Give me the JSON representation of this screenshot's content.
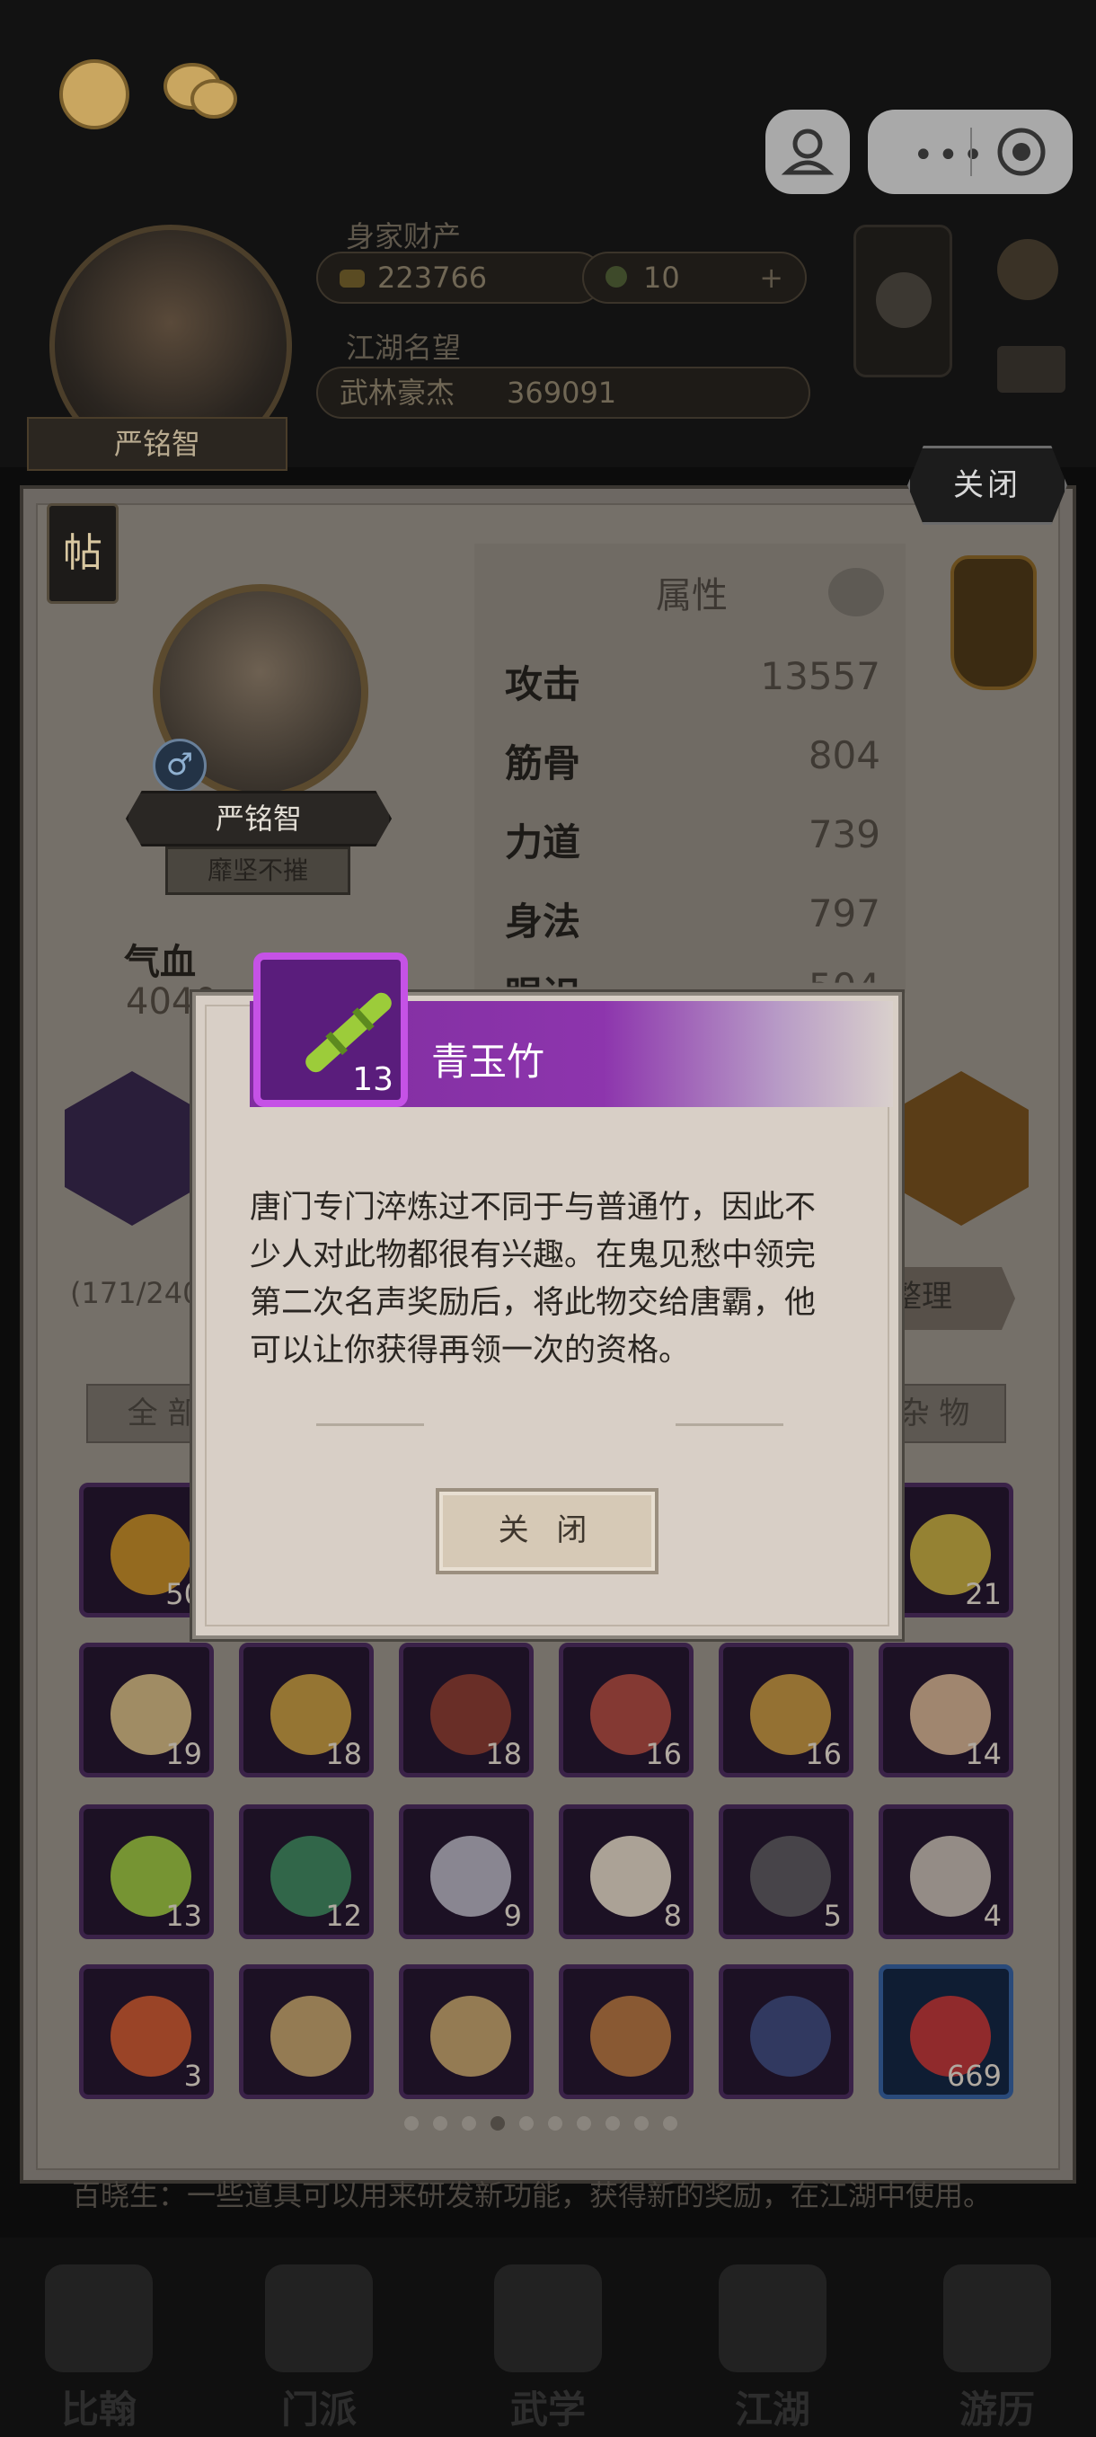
{
  "top": {
    "resources_label": "身家财产",
    "gold": "223766",
    "jade": "10",
    "plus": "+",
    "fame_label": "江湖名望",
    "fame_title": "武林豪杰",
    "fame_value": "369091",
    "player_name": "严铭智"
  },
  "panel": {
    "close_label": "关闭",
    "tie_label": "帖",
    "character_name": "严铭智",
    "character_title": "靡坚不摧",
    "gender_symbol": "♂",
    "hp_label": "气血",
    "hp_value": "4040",
    "attr_title": "属性",
    "attributes": [
      {
        "name": "攻击",
        "value": "13557"
      },
      {
        "name": "筋骨",
        "value": "804"
      },
      {
        "name": "力道",
        "value": "739"
      },
      {
        "name": "身法",
        "value": "797"
      },
      {
        "name": "眼识",
        "value": "504"
      }
    ],
    "capacity": "(171/240)",
    "arrange_label": "整理",
    "tab_all": "全 部",
    "tab_misc": "杂 物",
    "footer_text": "百晓生：一些道具可以用来研发新功能，获得新的奖励，在江湖中使用。"
  },
  "items": [
    [
      {
        "count": "50",
        "art": "#c8901e"
      },
      {
        "count": "",
        "art": "#6a4a2a"
      },
      {
        "count": "",
        "art": "#5a3a2a"
      },
      {
        "count": "",
        "art": "#6a5a4a"
      },
      {
        "count": "",
        "art": "#7a5a2a"
      },
      {
        "count": "21",
        "art": "#c9b23a"
      }
    ],
    [
      {
        "count": "19",
        "art": "#d8c080"
      },
      {
        "count": "18",
        "art": "#c9a03a"
      },
      {
        "count": "18",
        "art": "#8a3a2a"
      },
      {
        "count": "16",
        "art": "#b04a3a"
      },
      {
        "count": "16",
        "art": "#c89a3a"
      },
      {
        "count": "14",
        "art": "#d8b890"
      }
    ],
    [
      {
        "count": "13",
        "art": "#9ccc3a"
      },
      {
        "count": "12",
        "art": "#3a8a5a"
      },
      {
        "count": "9",
        "art": "#b8b8c0"
      },
      {
        "count": "8",
        "art": "#e8e0c8"
      },
      {
        "count": "5",
        "art": "#5a5a5a"
      },
      {
        "count": "4",
        "art": "#c8c0b0"
      }
    ],
    [
      {
        "count": "3",
        "art": "#d05a2a"
      },
      {
        "count": "",
        "art": "#c8a868"
      },
      {
        "count": "",
        "art": "#c8a868"
      },
      {
        "count": "",
        "art": "#b8783a"
      },
      {
        "count": "",
        "art": "#3a4a7a"
      },
      {
        "count": "669",
        "art": "#c8302a",
        "blue": true
      }
    ]
  ],
  "dialog": {
    "item_name": "青玉竹",
    "item_count": "13",
    "description": "唐门专门淬炼过不同于与普通竹，因此不少人对此物都很有兴趣。在鬼见愁中领完第二次名声奖励后，将此物交给唐霸，他可以让你获得再领一次的资格。",
    "close_label": "关 闭"
  },
  "nav": [
    "比翰",
    "门派",
    "武学",
    "江湖",
    "游历"
  ],
  "colors": {
    "dialog_header": "#8d35ad",
    "item_border": "#c552e6",
    "slot_bg": "#1c1124"
  },
  "icons": {
    "avatar": "avatar-icon",
    "chat": "chat-icon",
    "settings": "gear-icon",
    "mail": "mail-icon",
    "eye": "eye-icon"
  }
}
